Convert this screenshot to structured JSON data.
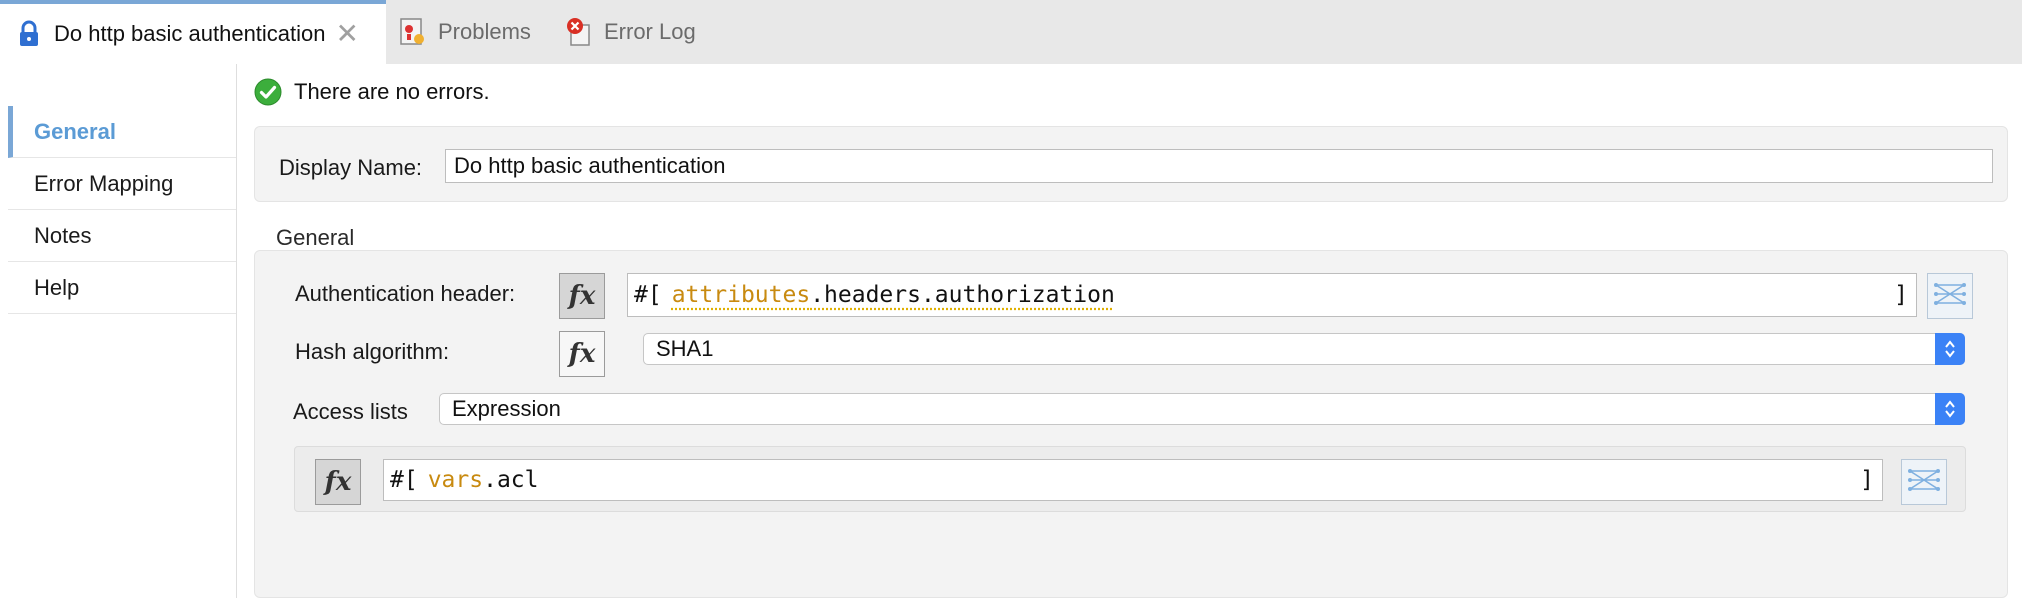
{
  "tabs": [
    {
      "label": "Do http basic authentication",
      "icon": "lock-icon",
      "active": true
    },
    {
      "label": "Problems",
      "icon": "problems-icon",
      "active": false
    },
    {
      "label": "Error Log",
      "icon": "error-log-icon",
      "active": false
    }
  ],
  "sidebar": {
    "items": [
      {
        "label": "General",
        "active": true
      },
      {
        "label": "Error Mapping"
      },
      {
        "label": "Notes"
      },
      {
        "label": "Help"
      }
    ]
  },
  "status": {
    "text": "There are no errors.",
    "icon": "check-circle-icon"
  },
  "display_name": {
    "label": "Display Name:",
    "value": "Do http basic authentication"
  },
  "general": {
    "title": "General",
    "auth_header": {
      "label": "Authentication header:",
      "prefix": "#[",
      "keyword": "attributes",
      "rest": ".headers.authorization",
      "suffix": "]"
    },
    "hash_algorithm": {
      "label": "Hash algorithm:",
      "value": "SHA1"
    },
    "access_lists": {
      "label": "Access lists",
      "value": "Expression"
    },
    "acl_expr": {
      "prefix": "#[",
      "keyword": "vars",
      "rest": ".acl",
      "suffix": "]"
    },
    "fx_label": "fx"
  },
  "colors": {
    "accent": "#7aa7d6",
    "active_text": "#5b9bd5",
    "keyword": "#c88a10",
    "select_arrow": "#3b82f6",
    "ok_green": "#3cae3c"
  }
}
